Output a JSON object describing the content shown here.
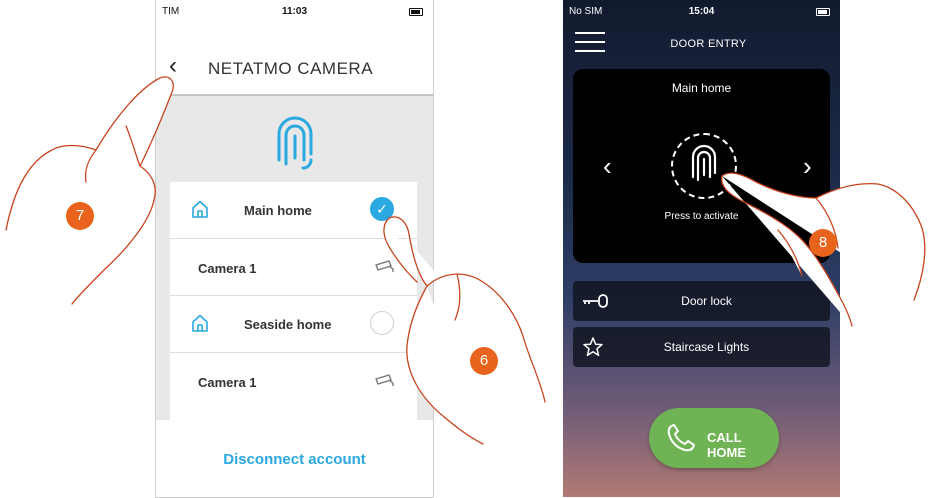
{
  "left_phone": {
    "status_bar": {
      "carrier": "TIM",
      "time": "11:03"
    },
    "header": {
      "back": "‹",
      "title": "NETATMO CAMERA"
    },
    "rows": [
      {
        "type": "home",
        "label": "Main home",
        "selected": true
      },
      {
        "type": "camera",
        "label": "Camera 1"
      },
      {
        "type": "home",
        "label": "Seaside home",
        "selected": false
      },
      {
        "type": "camera",
        "label": "Camera 1"
      }
    ],
    "footer": {
      "button": "Disconnect account"
    },
    "colors": {
      "accent": "#2aa8e0"
    }
  },
  "right_phone": {
    "status_bar": {
      "carrier": "No SIM",
      "time": "15:04"
    },
    "header": {
      "title": "DOOR ENTRY"
    },
    "card": {
      "home_name": "Main home",
      "prev": "‹",
      "next": "›",
      "action_label": "Press to activate"
    },
    "actions": [
      {
        "label": "Door lock",
        "icon": "key-icon"
      },
      {
        "label": "Staircase Lights",
        "icon": "star-icon"
      }
    ],
    "call_button": {
      "label": "CALL HOME",
      "icon": "phone-icon"
    },
    "colors": {
      "call": "#6fb355"
    }
  },
  "callouts": {
    "six": "6",
    "seven": "7",
    "eight": "8"
  }
}
